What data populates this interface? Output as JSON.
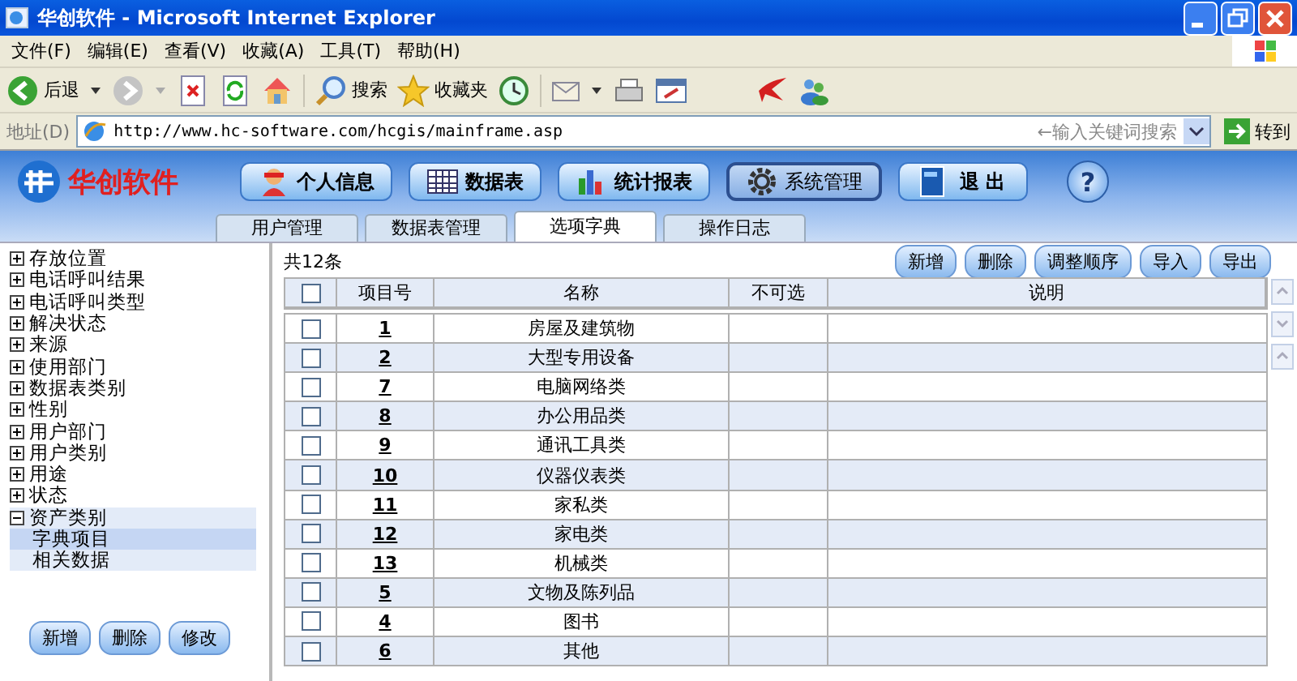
{
  "window": {
    "title": "华创软件 - Microsoft Internet Explorer"
  },
  "menu": [
    "文件(F)",
    "编辑(E)",
    "查看(V)",
    "收藏(A)",
    "工具(T)",
    "帮助(H)"
  ],
  "toolbar": {
    "back": "后退",
    "search": "搜索",
    "favorites": "收藏夹"
  },
  "address": {
    "label": "地址(D)",
    "url": "http://www.hc-software.com/hcgis/mainframe.asp",
    "placeholder": "←输入关键词搜索",
    "go": "转到"
  },
  "app": {
    "logo": "华创软件",
    "help": "?",
    "nav": [
      {
        "label": "个人信息",
        "kind": "person",
        "selected": false
      },
      {
        "label": "数据表",
        "kind": "grid",
        "selected": false
      },
      {
        "label": "统计报表",
        "kind": "chart",
        "selected": false
      },
      {
        "label": "系统管理",
        "kind": "gear",
        "selected": true
      },
      {
        "label": "退 出",
        "kind": "exit",
        "selected": false
      }
    ]
  },
  "tabs": [
    {
      "label": "用户管理",
      "selected": false
    },
    {
      "label": "数据表管理",
      "selected": false
    },
    {
      "label": "选项字典",
      "selected": true
    },
    {
      "label": "操作日志",
      "selected": false
    }
  ],
  "tree": {
    "items": [
      {
        "label": "存放位置",
        "expanded": false
      },
      {
        "label": "电话呼叫结果",
        "expanded": false
      },
      {
        "label": "电话呼叫类型",
        "expanded": false
      },
      {
        "label": "解决状态",
        "expanded": false
      },
      {
        "label": "来源",
        "expanded": false
      },
      {
        "label": "使用部门",
        "expanded": false
      },
      {
        "label": "数据表类别",
        "expanded": false
      },
      {
        "label": "性别",
        "expanded": false
      },
      {
        "label": "用户部门",
        "expanded": false
      },
      {
        "label": "用户类别",
        "expanded": false
      },
      {
        "label": "用途",
        "expanded": false
      },
      {
        "label": "状态",
        "expanded": false
      },
      {
        "label": "资产类别",
        "expanded": true,
        "children": [
          {
            "label": "字典项目",
            "selected": true
          },
          {
            "label": "相关数据",
            "selected": false
          }
        ]
      }
    ],
    "buttons": [
      "新增",
      "删除",
      "修改"
    ]
  },
  "list": {
    "count": "共12条",
    "buttons": [
      "新增",
      "删除",
      "调整顺序",
      "导入",
      "导出"
    ],
    "header_checkbox": {
      "checked": false
    },
    "columns": [
      "项目号",
      "名称",
      "不可选",
      "说明"
    ],
    "rows": [
      {
        "checked": false,
        "id": "1",
        "name": "房屋及建筑物"
      },
      {
        "checked": false,
        "id": "2",
        "name": "大型专用设备"
      },
      {
        "checked": false,
        "id": "7",
        "name": "电脑网络类"
      },
      {
        "checked": false,
        "id": "8",
        "name": "办公用品类"
      },
      {
        "checked": false,
        "id": "9",
        "name": "通讯工具类"
      },
      {
        "checked": false,
        "id": "10",
        "name": "仪器仪表类"
      },
      {
        "checked": false,
        "id": "11",
        "name": "家私类"
      },
      {
        "checked": false,
        "id": "12",
        "name": "家电类"
      },
      {
        "checked": false,
        "id": "13",
        "name": "机械类"
      },
      {
        "checked": false,
        "id": "5",
        "name": "文物及陈列品"
      },
      {
        "checked": false,
        "id": "4",
        "name": "图书"
      },
      {
        "checked": false,
        "id": "6",
        "name": "其他"
      }
    ]
  }
}
